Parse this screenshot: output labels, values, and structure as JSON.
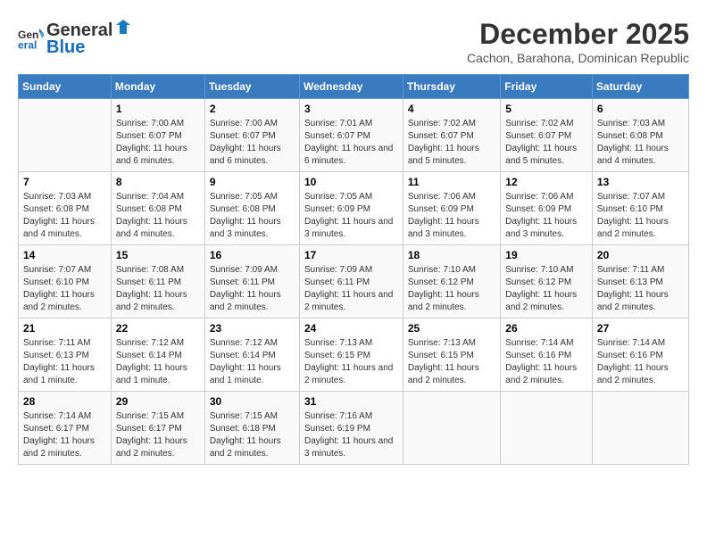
{
  "header": {
    "logo_line1": "General",
    "logo_line2": "Blue",
    "month": "December 2025",
    "location": "Cachon, Barahona, Dominican Republic"
  },
  "days_of_week": [
    "Sunday",
    "Monday",
    "Tuesday",
    "Wednesday",
    "Thursday",
    "Friday",
    "Saturday"
  ],
  "weeks": [
    [
      {
        "day": "",
        "sunrise": "",
        "sunset": "",
        "daylight": ""
      },
      {
        "day": "1",
        "sunrise": "Sunrise: 7:00 AM",
        "sunset": "Sunset: 6:07 PM",
        "daylight": "Daylight: 11 hours and 6 minutes."
      },
      {
        "day": "2",
        "sunrise": "Sunrise: 7:00 AM",
        "sunset": "Sunset: 6:07 PM",
        "daylight": "Daylight: 11 hours and 6 minutes."
      },
      {
        "day": "3",
        "sunrise": "Sunrise: 7:01 AM",
        "sunset": "Sunset: 6:07 PM",
        "daylight": "Daylight: 11 hours and 6 minutes."
      },
      {
        "day": "4",
        "sunrise": "Sunrise: 7:02 AM",
        "sunset": "Sunset: 6:07 PM",
        "daylight": "Daylight: 11 hours and 5 minutes."
      },
      {
        "day": "5",
        "sunrise": "Sunrise: 7:02 AM",
        "sunset": "Sunset: 6:07 PM",
        "daylight": "Daylight: 11 hours and 5 minutes."
      },
      {
        "day": "6",
        "sunrise": "Sunrise: 7:03 AM",
        "sunset": "Sunset: 6:08 PM",
        "daylight": "Daylight: 11 hours and 4 minutes."
      }
    ],
    [
      {
        "day": "7",
        "sunrise": "Sunrise: 7:03 AM",
        "sunset": "Sunset: 6:08 PM",
        "daylight": "Daylight: 11 hours and 4 minutes."
      },
      {
        "day": "8",
        "sunrise": "Sunrise: 7:04 AM",
        "sunset": "Sunset: 6:08 PM",
        "daylight": "Daylight: 11 hours and 4 minutes."
      },
      {
        "day": "9",
        "sunrise": "Sunrise: 7:05 AM",
        "sunset": "Sunset: 6:08 PM",
        "daylight": "Daylight: 11 hours and 3 minutes."
      },
      {
        "day": "10",
        "sunrise": "Sunrise: 7:05 AM",
        "sunset": "Sunset: 6:09 PM",
        "daylight": "Daylight: 11 hours and 3 minutes."
      },
      {
        "day": "11",
        "sunrise": "Sunrise: 7:06 AM",
        "sunset": "Sunset: 6:09 PM",
        "daylight": "Daylight: 11 hours and 3 minutes."
      },
      {
        "day": "12",
        "sunrise": "Sunrise: 7:06 AM",
        "sunset": "Sunset: 6:09 PM",
        "daylight": "Daylight: 11 hours and 3 minutes."
      },
      {
        "day": "13",
        "sunrise": "Sunrise: 7:07 AM",
        "sunset": "Sunset: 6:10 PM",
        "daylight": "Daylight: 11 hours and 2 minutes."
      }
    ],
    [
      {
        "day": "14",
        "sunrise": "Sunrise: 7:07 AM",
        "sunset": "Sunset: 6:10 PM",
        "daylight": "Daylight: 11 hours and 2 minutes."
      },
      {
        "day": "15",
        "sunrise": "Sunrise: 7:08 AM",
        "sunset": "Sunset: 6:11 PM",
        "daylight": "Daylight: 11 hours and 2 minutes."
      },
      {
        "day": "16",
        "sunrise": "Sunrise: 7:09 AM",
        "sunset": "Sunset: 6:11 PM",
        "daylight": "Daylight: 11 hours and 2 minutes."
      },
      {
        "day": "17",
        "sunrise": "Sunrise: 7:09 AM",
        "sunset": "Sunset: 6:11 PM",
        "daylight": "Daylight: 11 hours and 2 minutes."
      },
      {
        "day": "18",
        "sunrise": "Sunrise: 7:10 AM",
        "sunset": "Sunset: 6:12 PM",
        "daylight": "Daylight: 11 hours and 2 minutes."
      },
      {
        "day": "19",
        "sunrise": "Sunrise: 7:10 AM",
        "sunset": "Sunset: 6:12 PM",
        "daylight": "Daylight: 11 hours and 2 minutes."
      },
      {
        "day": "20",
        "sunrise": "Sunrise: 7:11 AM",
        "sunset": "Sunset: 6:13 PM",
        "daylight": "Daylight: 11 hours and 2 minutes."
      }
    ],
    [
      {
        "day": "21",
        "sunrise": "Sunrise: 7:11 AM",
        "sunset": "Sunset: 6:13 PM",
        "daylight": "Daylight: 11 hours and 1 minute."
      },
      {
        "day": "22",
        "sunrise": "Sunrise: 7:12 AM",
        "sunset": "Sunset: 6:14 PM",
        "daylight": "Daylight: 11 hours and 1 minute."
      },
      {
        "day": "23",
        "sunrise": "Sunrise: 7:12 AM",
        "sunset": "Sunset: 6:14 PM",
        "daylight": "Daylight: 11 hours and 1 minute."
      },
      {
        "day": "24",
        "sunrise": "Sunrise: 7:13 AM",
        "sunset": "Sunset: 6:15 PM",
        "daylight": "Daylight: 11 hours and 2 minutes."
      },
      {
        "day": "25",
        "sunrise": "Sunrise: 7:13 AM",
        "sunset": "Sunset: 6:15 PM",
        "daylight": "Daylight: 11 hours and 2 minutes."
      },
      {
        "day": "26",
        "sunrise": "Sunrise: 7:14 AM",
        "sunset": "Sunset: 6:16 PM",
        "daylight": "Daylight: 11 hours and 2 minutes."
      },
      {
        "day": "27",
        "sunrise": "Sunrise: 7:14 AM",
        "sunset": "Sunset: 6:16 PM",
        "daylight": "Daylight: 11 hours and 2 minutes."
      }
    ],
    [
      {
        "day": "28",
        "sunrise": "Sunrise: 7:14 AM",
        "sunset": "Sunset: 6:17 PM",
        "daylight": "Daylight: 11 hours and 2 minutes."
      },
      {
        "day": "29",
        "sunrise": "Sunrise: 7:15 AM",
        "sunset": "Sunset: 6:17 PM",
        "daylight": "Daylight: 11 hours and 2 minutes."
      },
      {
        "day": "30",
        "sunrise": "Sunrise: 7:15 AM",
        "sunset": "Sunset: 6:18 PM",
        "daylight": "Daylight: 11 hours and 2 minutes."
      },
      {
        "day": "31",
        "sunrise": "Sunrise: 7:16 AM",
        "sunset": "Sunset: 6:19 PM",
        "daylight": "Daylight: 11 hours and 3 minutes."
      },
      {
        "day": "",
        "sunrise": "",
        "sunset": "",
        "daylight": ""
      },
      {
        "day": "",
        "sunrise": "",
        "sunset": "",
        "daylight": ""
      },
      {
        "day": "",
        "sunrise": "",
        "sunset": "",
        "daylight": ""
      }
    ]
  ]
}
